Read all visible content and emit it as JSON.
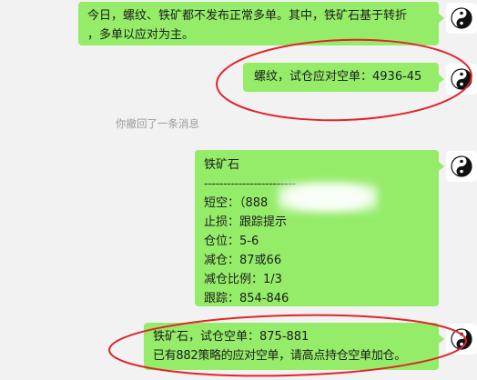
{
  "messages": [
    {
      "lines": [
        "今日，螺纹、铁矿都不发布正常多单。其中，铁矿石基于转折",
        "，多单以应对为主。"
      ]
    },
    {
      "lines": [
        "螺纹，试仓应对空单：4936-45"
      ]
    },
    {
      "lines": [
        "铁矿石",
        "------------------------",
        "短空：（888",
        "止损：跟踪提示",
        "仓位：5-6",
        "减仓：87或66",
        "减仓比例：1/3",
        "跟踪：854-846"
      ]
    },
    {
      "lines": [
        "铁矿石，试仓空单：875-881",
        "已有882策略的应对空单，请高点持仓空单加仓。"
      ]
    }
  ],
  "system_notice": "你撤回了一条消息",
  "colors": {
    "bubble": "#95ec69",
    "background": "#f2f2f2",
    "annotation": "#e0242a",
    "notice": "#9a9a9a"
  },
  "icons": {
    "avatar": "yin-yang-icon"
  }
}
